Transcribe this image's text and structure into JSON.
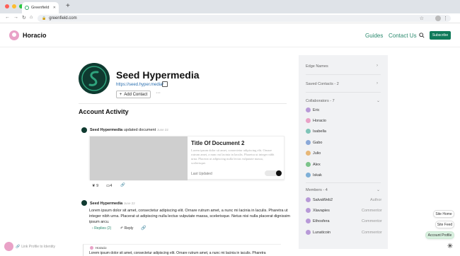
{
  "browser": {
    "tab_title": "Greenfield",
    "url": "greenfield.com",
    "colors": {
      "close": "#ff5f57",
      "min": "#febc2e",
      "max": "#28c840"
    }
  },
  "site": {
    "brand": "Horacio",
    "nav": [
      "Guides",
      "Contact Us"
    ],
    "subscribe_label": "Subscribe",
    "accent": "#107a5a"
  },
  "profile": {
    "name": "Seed Hypermedia",
    "link": "https://seed.hyper.media/",
    "add_contact_label": "Add Contact",
    "more_label": "···",
    "section_title": "Account Activity"
  },
  "feed": {
    "item1": {
      "author": "Seed Hypermedia",
      "action": "updated document",
      "date": "June 22",
      "card_title": "Title Of Document 2",
      "card_body": "Lorem ipsum dolor sit amet, consectetur adipiscing elit. Ornare rutrum amet, a nunc mi lacinia in laculis. Pharetra ut integer nibh urna. Placerat ut adipiscing nulla lectus vulputate massa, scelerisque.",
      "card_footer": "Last Updated",
      "likes": "9",
      "comments": "4"
    },
    "item2": {
      "author": "Seed Hypermedia",
      "date": "June 22",
      "text": "Lorem ipsum dolor sit amet, consectetur adipiscing elit. Ornare rutrum amet, a nunc mi lacinia in laculis. Pharetra ut integer nibh urna. Placerat ut adipiscing nulla lectus vulputate massa, scelerisque. Netus nisi nulla placerat dignissim ipsum arcu.",
      "replies_label": "Replies (2)",
      "reply_label": "Reply"
    },
    "nested": {
      "author": "Horacio",
      "text": "Lorem ipsum dolor sit amet, consectetur adipiscing elit. Ornare rutrum amet, a nunc mi lacinia in iaculis. Pharetra"
    }
  },
  "sidebar": {
    "edge_names": "Edge Names",
    "saved_contacts": "Saved Contacts - 2",
    "collaborators_title": "Collaborators - 7",
    "collaborators": [
      {
        "name": "Eric",
        "color": "#b89ad8"
      },
      {
        "name": "Horacio",
        "color": "#e9a2c7"
      },
      {
        "name": "Isabella",
        "color": "#7fc4b8"
      },
      {
        "name": "Gabo",
        "color": "#8aa8d8"
      },
      {
        "name": "Julio",
        "color": "#e7b777"
      },
      {
        "name": "Alex",
        "color": "#7cc48a"
      },
      {
        "name": "Iskak",
        "color": "#7fb0d8"
      }
    ],
    "members_title": "Members - 4",
    "members": [
      {
        "name": "SalvaWeb2",
        "role": "Author",
        "color": "#b89ad8"
      },
      {
        "name": "Xlavapies",
        "role": "Commentor",
        "color": "#b89ad8"
      },
      {
        "name": "Ethosfera",
        "role": "Commentor",
        "color": "#b89ad8"
      },
      {
        "name": "Lunaticoin",
        "role": "Commentor",
        "color": "#b89ad8"
      }
    ]
  },
  "footer": {
    "link_identity": "Link Profile to Identity",
    "site_home": "Site Home",
    "site_feed": "Site Feed",
    "account_profile": "Account Profile"
  }
}
